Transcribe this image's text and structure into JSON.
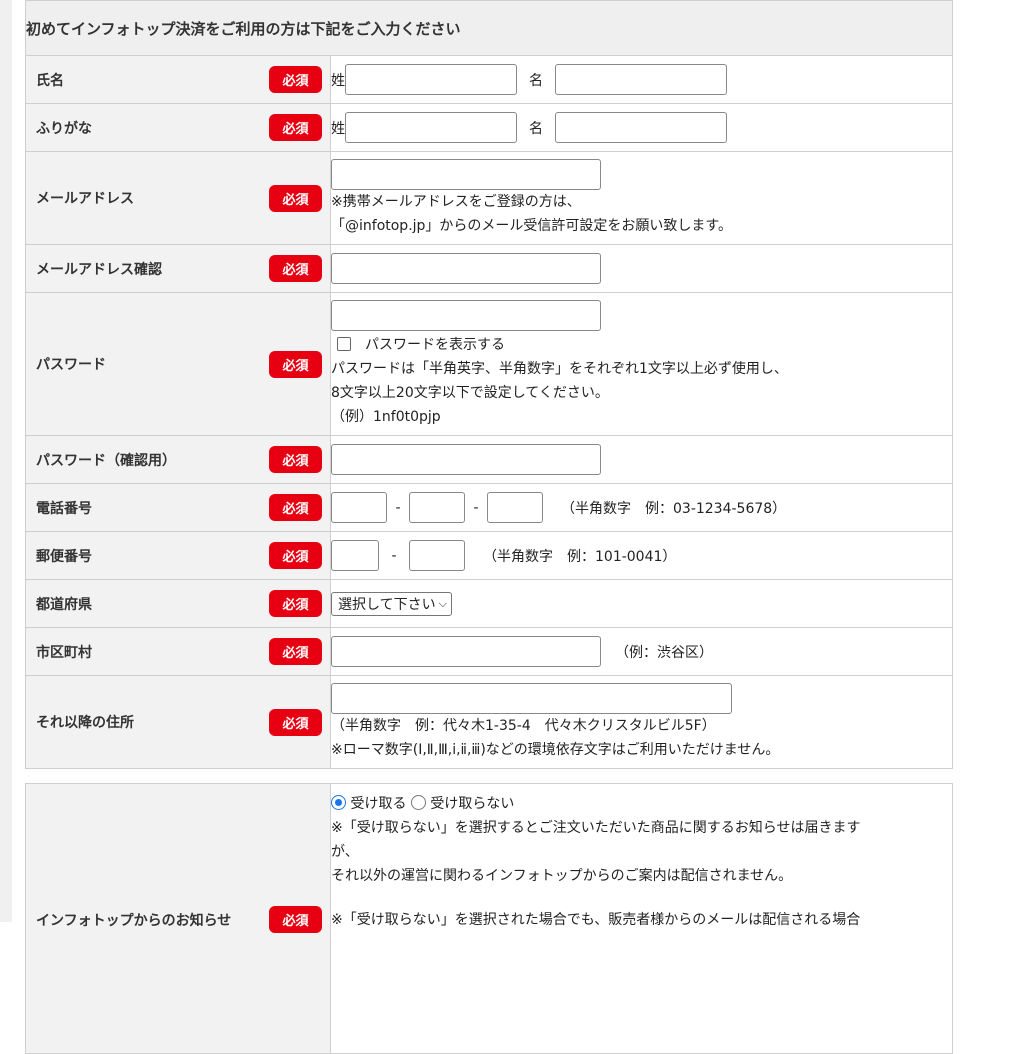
{
  "header": "初めてインフォトップ決済をご利用の方は下記をご入力ください",
  "required": "必須",
  "fields": {
    "name": {
      "label": "氏名",
      "sei": "姓",
      "mei": "名"
    },
    "kana": {
      "label": "ふりがな",
      "sei": "姓",
      "mei": "名"
    },
    "email": {
      "label": "メールアドレス",
      "note1": "※携帯メールアドレスをご登録の方は、",
      "note2": "「@infotop.jp」からのメール受信許可設定をお願い致します。"
    },
    "email_confirm": {
      "label": "メールアドレス確認"
    },
    "password": {
      "label": "パスワード",
      "show": "パスワードを表示する",
      "note1": "パスワードは「半角英字、半角数字」をそれぞれ1文字以上必ず使用し、",
      "note2": "8文字以上20文字以下で設定してください。",
      "note3": "（例）1nf0t0pjp"
    },
    "password_confirm": {
      "label": "パスワード（確認用）"
    },
    "phone": {
      "label": "電話番号",
      "dash": "-",
      "hint": "（半角数字　例：03-1234-5678）"
    },
    "zip": {
      "label": "郵便番号",
      "dash": "-",
      "hint": "（半角数字　例：101-0041）"
    },
    "pref": {
      "label": "都道府県",
      "select": "選択して下さい"
    },
    "city": {
      "label": "市区町村",
      "hint": "（例：渋谷区）"
    },
    "address": {
      "label": "それ以降の住所",
      "note1": "（半角数字　例：代々木1-35-4　代々木クリスタルビル5F）",
      "note2": "※ローマ数字(Ⅰ,Ⅱ,Ⅲ,ⅰ,ⅱ,ⅲ)などの環境依存文字はご利用いただけません。"
    }
  },
  "notice": {
    "label": "インフォトップからのお知らせ",
    "opt_receive": "受け取る",
    "opt_decline": "受け取らない",
    "selected": "受け取る",
    "note1": "※「受け取らない」を選択するとご注文いただいた商品に関するお知らせは届きます",
    "note1b": "が、",
    "note2": "それ以外の運営に関わるインフォトップからのご案内は配信されません。",
    "note3": "※「受け取らない」を選択された場合でも、販売者様からのメールは配信される場合"
  }
}
